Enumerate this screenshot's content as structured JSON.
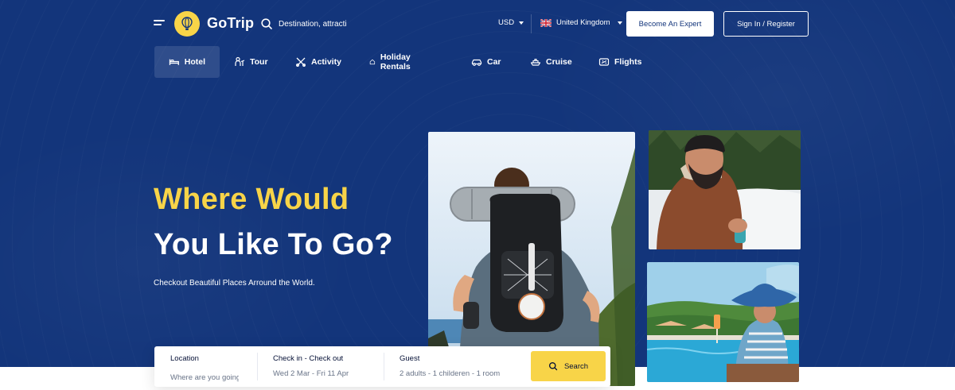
{
  "header": {
    "brand": "GoTrip",
    "search_placeholder": "Destination, attractions",
    "currency": "USD",
    "language": "United Kingdom",
    "expert_button": "Become An Expert",
    "signin_button": "Sign In / Register"
  },
  "tabs": [
    {
      "label": "Hotel",
      "icon": "bed-icon",
      "active": true
    },
    {
      "label": "Tour",
      "icon": "tour-guide-icon"
    },
    {
      "label": "Activity",
      "icon": "activity-icon"
    },
    {
      "label": "Holiday Rentals",
      "icon": "home-icon"
    },
    {
      "label": "Car",
      "icon": "car-icon"
    },
    {
      "label": "Cruise",
      "icon": "ship-icon"
    },
    {
      "label": "Flights",
      "icon": "plane-icon"
    }
  ],
  "hero": {
    "headline_line1": "Where Would",
    "headline_line2": "You Like To Go?",
    "subtitle": "Checkout Beautiful Places Arround the World."
  },
  "search": {
    "location_label": "Location",
    "location_placeholder": "Where are you going?",
    "dates_label": "Check in - Check out",
    "dates_value": "Wed 2 Mar - Fri 11 Apr",
    "guest_label": "Guest",
    "guest_value": "2 adults - 1 childeren - 1 room",
    "button": "Search"
  },
  "colors": {
    "hero_bg": "#13357b",
    "accent_yellow": "#f8d448",
    "dark_text": "#051036"
  }
}
